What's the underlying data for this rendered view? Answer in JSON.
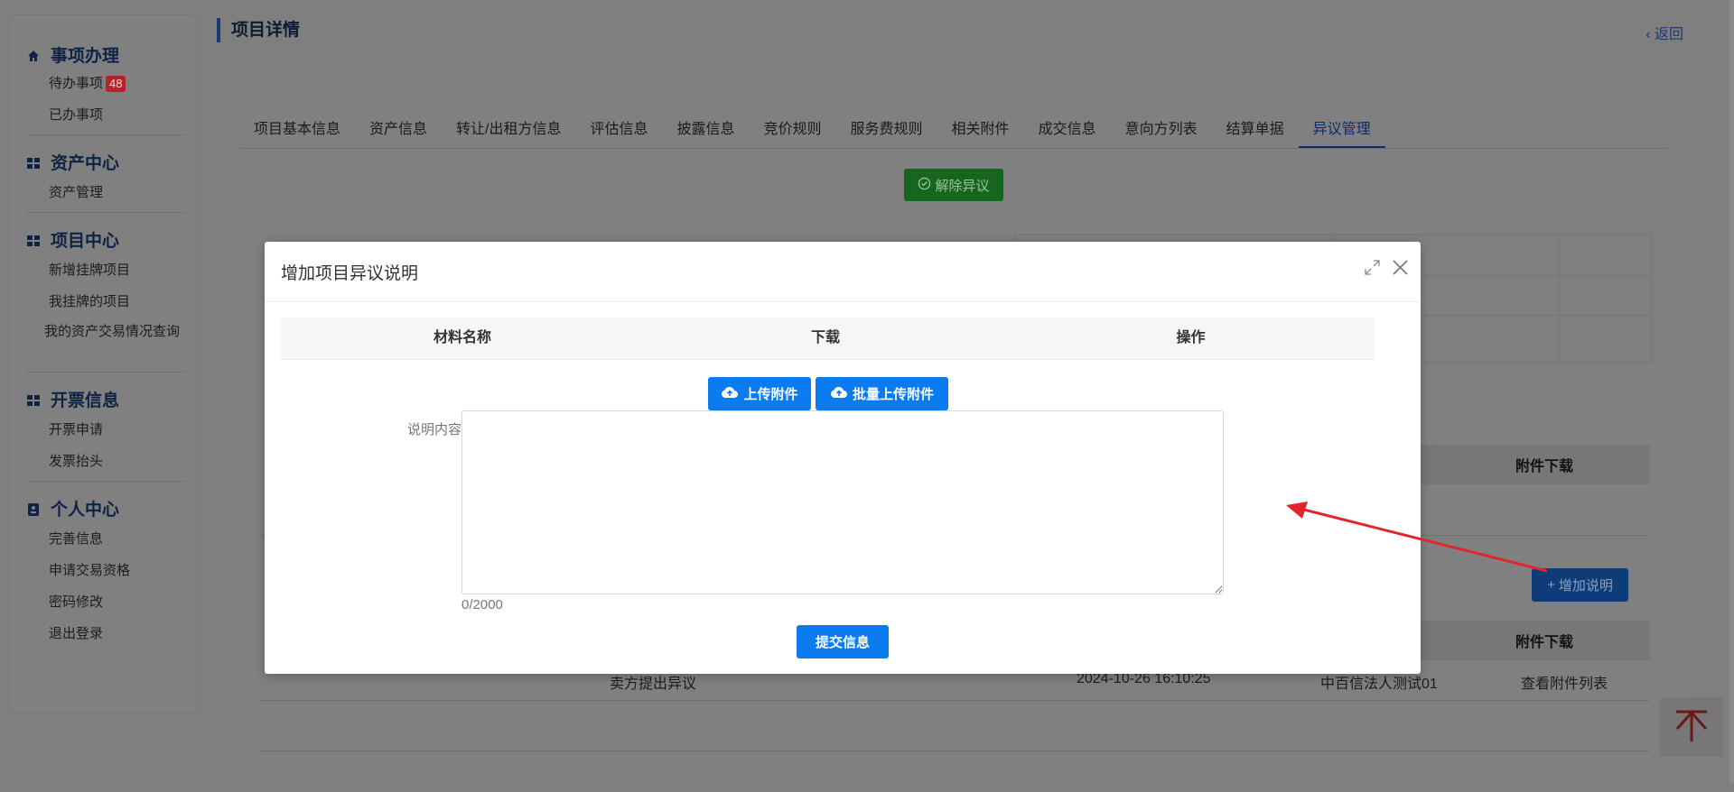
{
  "sidebar": {
    "groups": [
      {
        "title": "事项办理",
        "icon": "home-icon",
        "items": [
          "待办事项",
          "已办事项"
        ],
        "badge": "48"
      },
      {
        "title": "资产中心",
        "icon": "grid-icon",
        "items": [
          "资产管理"
        ]
      },
      {
        "title": "项目中心",
        "icon": "grid-icon",
        "items": [
          "新增挂牌项目",
          "我挂牌的项目",
          "我的资产交易情况查询"
        ]
      },
      {
        "title": "开票信息",
        "icon": "grid-icon",
        "items": [
          "开票申请",
          "发票抬头"
        ]
      },
      {
        "title": "个人中心",
        "icon": "id-card-icon",
        "items": [
          "完善信息",
          "申请交易资格",
          "密码修改",
          "退出登录"
        ]
      }
    ]
  },
  "header": {
    "title": "项目详情",
    "back_label": "返回"
  },
  "tabs": [
    "项目基本信息",
    "资产信息",
    "转让/出租方信息",
    "评估信息",
    "披露信息",
    "竞价规则",
    "服务费规则",
    "相关附件",
    "成交信息",
    "意向方列表",
    "结算单据",
    "异议管理"
  ],
  "active_tab": "异议管理",
  "objection": {
    "release_label": "解除异议",
    "add_label": "增加说明",
    "attachment_header": "附件下载",
    "row": {
      "type": "卖方提出异议",
      "time": "2024-10-26 16:10:25",
      "submitter": "中百信法人测试01",
      "action": "查看附件列表"
    }
  },
  "modal": {
    "title": "增加项目异议说明",
    "table_headers": [
      "材料名称",
      "下载",
      "操作"
    ],
    "upload_label": "上传附件",
    "batch_upload_label": "批量上传附件",
    "desc_label": "说明内容",
    "desc_value": "",
    "counter": "0/2000",
    "submit_label": "提交信息"
  },
  "colors": {
    "primary": "#0b7bf0",
    "release_green": "#2fb53a",
    "badge_red": "#e63a45",
    "annotation_arrow": "#e0262c"
  }
}
